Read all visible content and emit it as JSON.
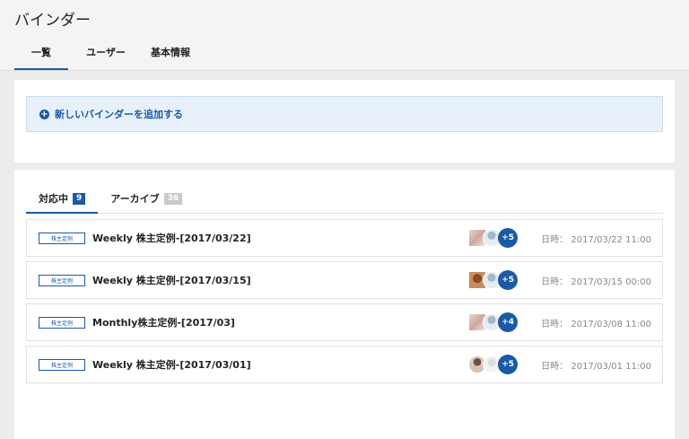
{
  "header": {
    "title": "バインダー"
  },
  "tabs": [
    {
      "label": "一覧",
      "active": true
    },
    {
      "label": "ユーザー",
      "active": false
    },
    {
      "label": "基本情報",
      "active": false
    }
  ],
  "add_button": {
    "label": "新しいバインダーを追加する"
  },
  "subtabs": [
    {
      "label": "対応中",
      "count": "9"
    },
    {
      "label": "アーカイブ",
      "count": "36"
    }
  ],
  "date_prefix": "日時：",
  "rows": [
    {
      "tag": "株主定例",
      "title": "Weekly 株主定例-[2017/03/22]",
      "more": "+5",
      "date": "2017/03/22 11:00"
    },
    {
      "tag": "株主定例",
      "title": "Weekly 株主定例-[2017/03/15]",
      "more": "+5",
      "date": "2017/03/15 00:00"
    },
    {
      "tag": "株主定例",
      "title": "Monthly株主定例-[2017/03]",
      "more": "+4",
      "date": "2017/03/08 11:00"
    },
    {
      "tag": "株主定例",
      "title": "Weekly 株主定例-[2017/03/01]",
      "more": "+5",
      "date": "2017/03/01 11:00"
    }
  ],
  "colors": {
    "accent": "#1a5aa6",
    "add_bar_bg": "#e7f0f9"
  }
}
